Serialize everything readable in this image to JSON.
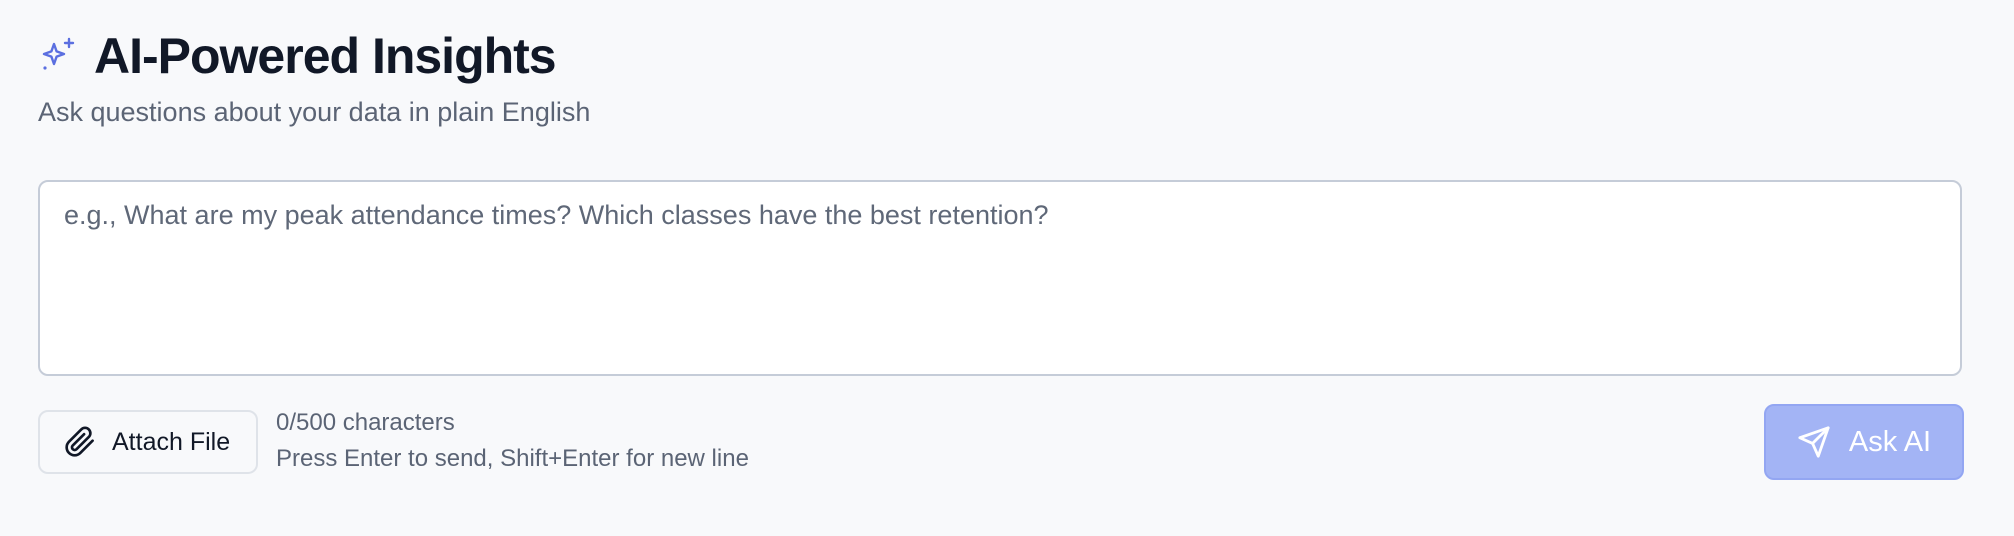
{
  "header": {
    "icon": "sparkle-icon",
    "title": "AI-Powered Insights",
    "subtitle": "Ask questions about your data in plain English"
  },
  "query": {
    "value": "",
    "placeholder": "e.g., What are my peak attendance times? Which classes have the best retention?"
  },
  "footer": {
    "attach_icon": "paperclip-icon",
    "attach_label": "Attach File",
    "char_count": "0/500 characters",
    "hint": "Press Enter to send, Shift+Enter for new line",
    "ask_icon": "send-icon",
    "ask_label": "Ask AI"
  },
  "colors": {
    "accent": "#5b6fe0",
    "ask_button_disabled": "#a3b4f5",
    "background": "#f8f9fb"
  }
}
